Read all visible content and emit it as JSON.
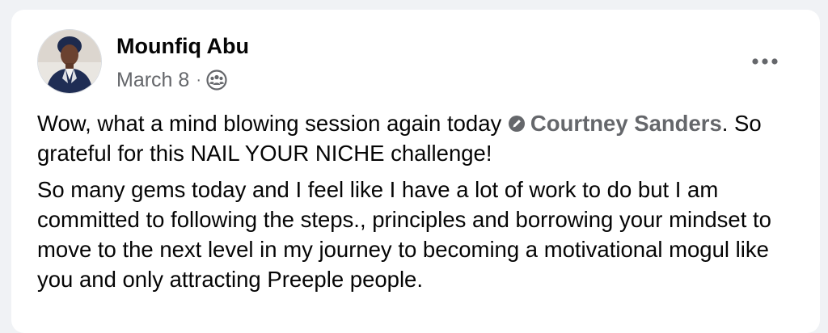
{
  "post": {
    "author_name": "Mounfiq Abu",
    "date": "March 8",
    "separator": "·",
    "audience_icon": "group-audience-icon",
    "more_icon": "more-options-icon",
    "body": {
      "paragraph1_prefix": "Wow, what a mind blowing session again today ",
      "mention_name": "Courtney Sanders",
      "mention_icon": "mention-badge-icon",
      "paragraph1_suffix": ". So grateful for this NAIL YOUR NICHE challenge!",
      "paragraph2": "So many gems today and I feel like I have a lot of work to do but I am committed to following the steps., principles and borrowing your mindset to move to the next level in my journey to becoming a motivational mogul like you and only attracting Preeple people."
    }
  },
  "colors": {
    "background": "#f0f2f5",
    "card": "#ffffff",
    "text_primary": "#050505",
    "text_secondary": "#65676b"
  }
}
